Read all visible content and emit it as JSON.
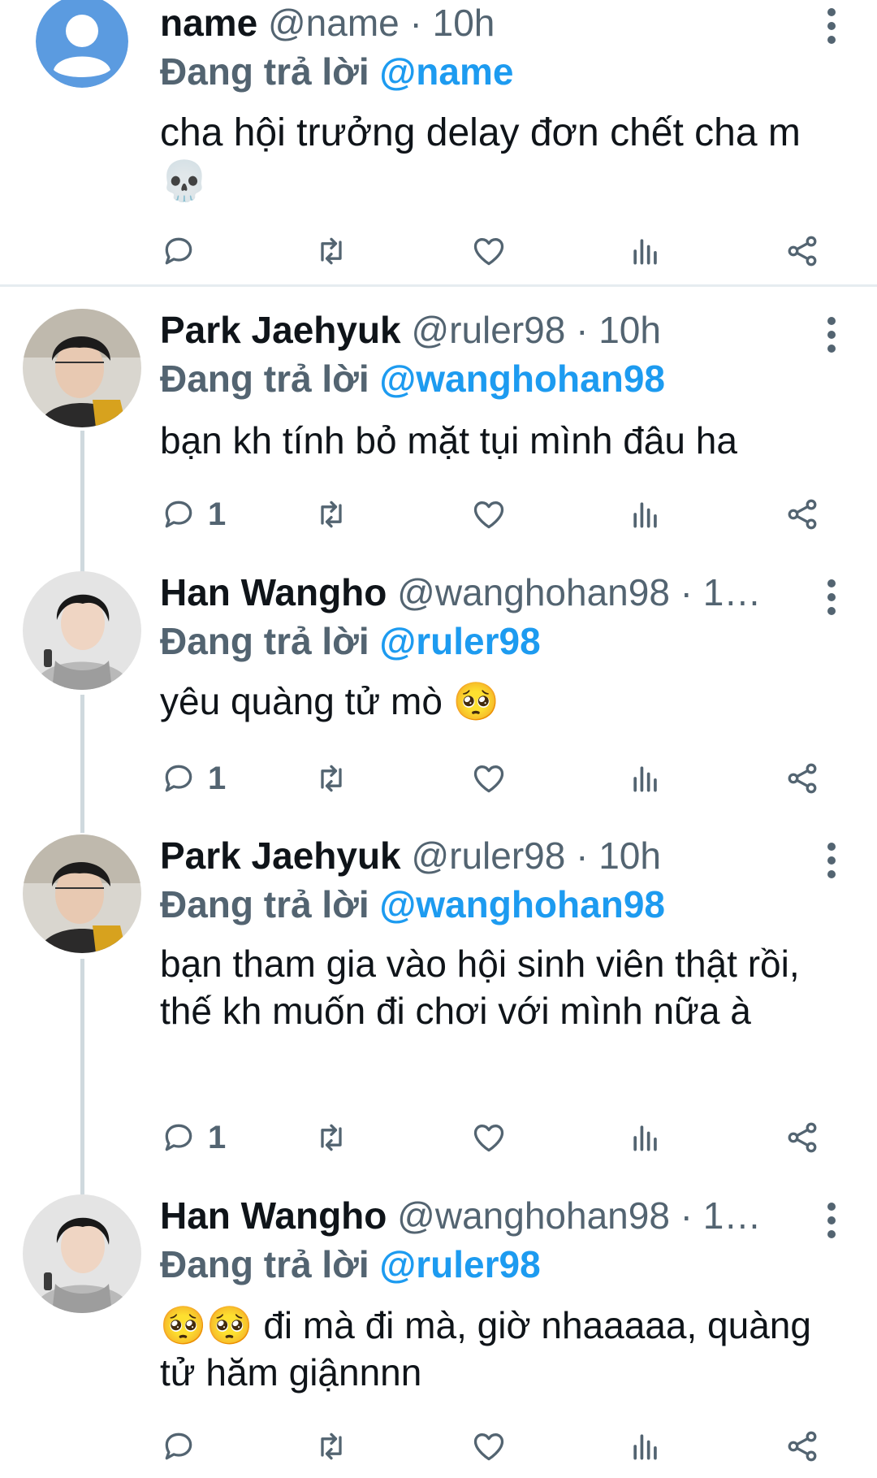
{
  "tweets": [
    {
      "name": "name",
      "handle": "@name",
      "dot": " · ",
      "time": "10h",
      "replying_prefix": "Đang trả lời ",
      "replying_to": "@name",
      "text": "cha hội trưởng delay đơn chết cha m 💀",
      "reply_count": "",
      "avatar": "default-profile"
    },
    {
      "name": "Park Jaehyuk",
      "handle": "@ruler98",
      "dot": " · ",
      "time": "10h",
      "replying_prefix": "Đang trả lời ",
      "replying_to": "@wanghohan98",
      "text": "bạn kh tính bỏ mặt tụi mình đâu ha",
      "reply_count": "1",
      "avatar": "photo"
    },
    {
      "name": "Han Wangho",
      "handle": "@wanghohan98",
      "dot": " · ",
      "time": "1…",
      "replying_prefix": "Đang trả lời ",
      "replying_to": "@ruler98",
      "text": "yêu quàng tử mò 🥺",
      "reply_count": "1",
      "avatar": "photo"
    },
    {
      "name": "Park Jaehyuk",
      "handle": "@ruler98",
      "dot": " · ",
      "time": "10h",
      "replying_prefix": "Đang trả lời ",
      "replying_to": "@wanghohan98",
      "text": "bạn tham gia vào hội sinh viên thật rồi, thế kh muốn đi chơi với mình nữa à",
      "reply_count": "1",
      "avatar": "photo"
    },
    {
      "name": "Han Wangho",
      "handle": "@wanghohan98",
      "dot": " · ",
      "time": "1…",
      "replying_prefix": "Đang trả lời ",
      "replying_to": "@ruler98",
      "text": "🥺🥺 đi mà đi mà, giờ nhaaaaa, quàng tử hăm giậnnnn",
      "reply_count": "",
      "avatar": "photo"
    }
  ],
  "icons": {
    "reply": "reply-icon",
    "retweet": "retweet-icon",
    "like": "like-icon",
    "views": "views-icon",
    "share": "share-icon",
    "more": "more-icon"
  },
  "colors": {
    "accent": "#1d9bf0",
    "secondary_text": "#536471",
    "thread_line": "#cfd9de"
  }
}
